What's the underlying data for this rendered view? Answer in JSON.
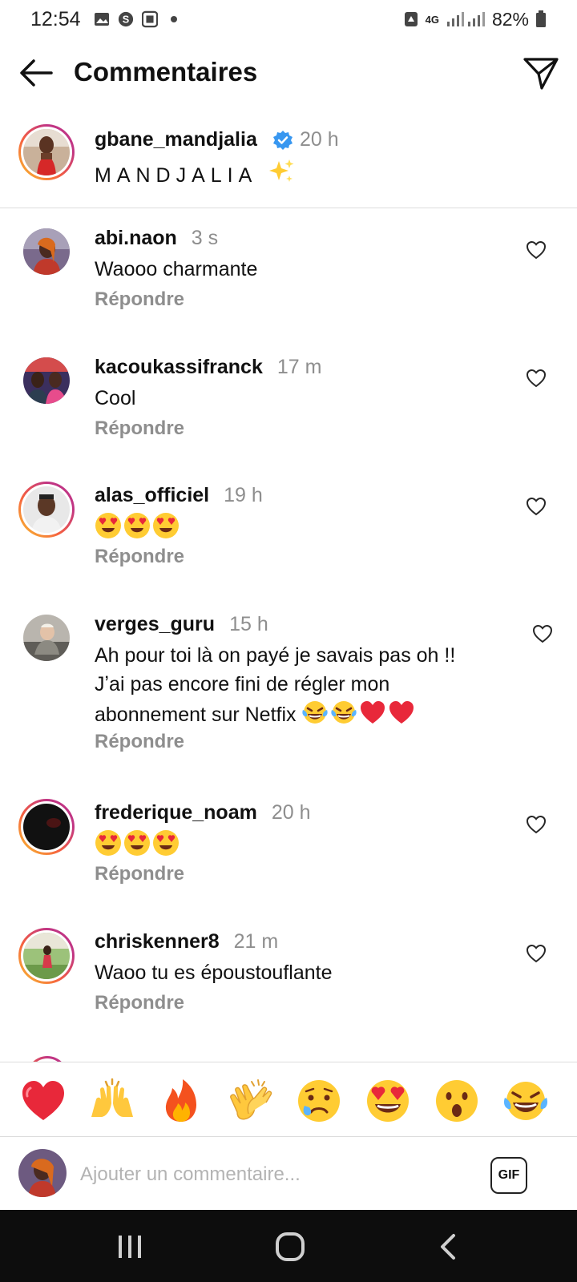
{
  "status_bar": {
    "time": "12:54",
    "network": "4G",
    "battery": "82%",
    "icons": [
      "gallery-icon",
      "app-s-icon",
      "app-box-icon",
      "dot-icon",
      "recycle-icon",
      "signal-icon",
      "battery-icon"
    ]
  },
  "header": {
    "title": "Commentaires",
    "back_icon": "arrow-left-icon",
    "send_icon": "paper-plane-icon"
  },
  "caption": {
    "username": "gbane_mandjalia",
    "time": "20 h",
    "text": "MANDJALIA"
  },
  "comments": [
    {
      "username": "abi.naon",
      "time": "3 s",
      "text": "Waooo charmante",
      "reply": "Répondre"
    },
    {
      "username": "kacoukassifranck",
      "time": "17 m",
      "text": "Cool",
      "reply": "Répondre"
    },
    {
      "username": "alas_officiel",
      "time": "19 h",
      "text": "",
      "reply": "Répondre"
    },
    {
      "username": "verges_guru",
      "time": "15 h",
      "text_line1": "Ah pour toi là on payé je savais pas oh !!",
      "text_line2": "Jʼai pas encore fini de régler mon",
      "text_line3": "abonnement sur Netfix",
      "reply": "Répondre"
    },
    {
      "username": "frederique_noam",
      "time": "20 h",
      "text": "",
      "reply": "Répondre"
    },
    {
      "username": "chriskenner8",
      "time": "21 m",
      "text": "Waoo tu es époustouflante",
      "reply": "Répondre"
    }
  ],
  "reactions": [
    "red-heart",
    "raising-hands",
    "fire",
    "clapping-hands",
    "crying-face",
    "heart-eyes",
    "surprised-face",
    "tears-of-joy"
  ],
  "composer": {
    "placeholder": "Ajouter un commentaire...",
    "gif_label": "GIF"
  },
  "colors": {
    "muted": "#8e8e8e",
    "verified": "#3897f0",
    "story_ring_start": "#f9c22e",
    "story_ring_end": "#c13584",
    "like_heart": "#262626"
  }
}
